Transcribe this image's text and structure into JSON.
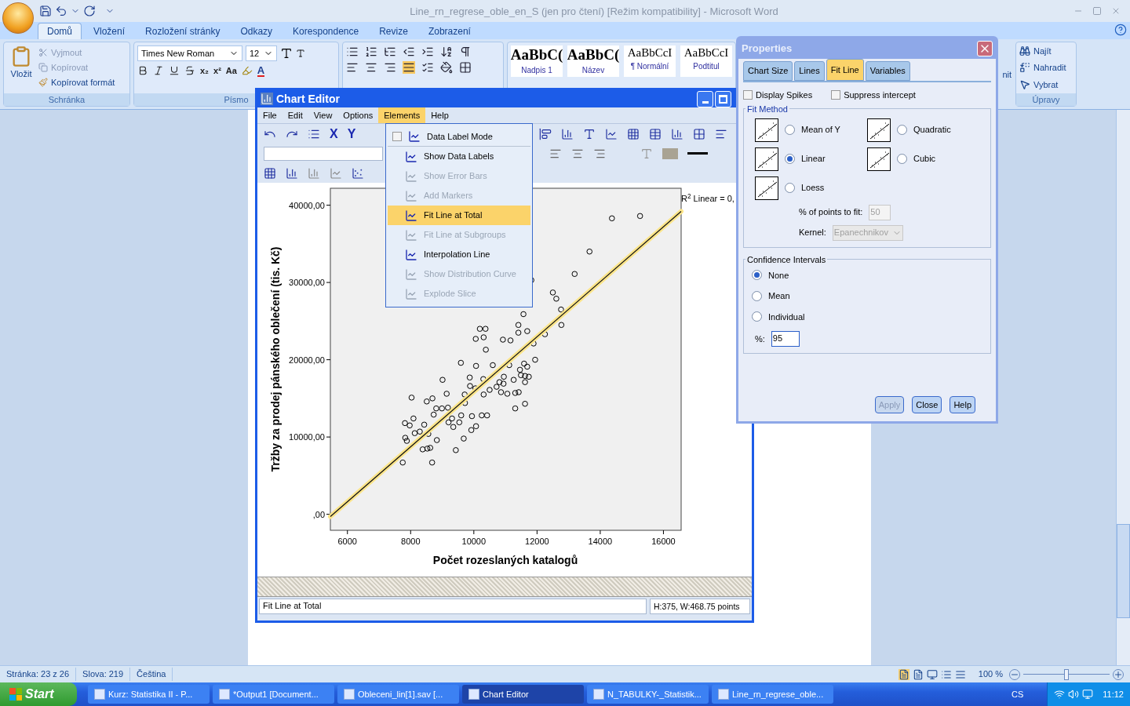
{
  "word": {
    "title": "Line_rn_regrese_oble_en_S (jen pro čtení) [Režim kompatibility] - Microsoft Word",
    "tabs": [
      {
        "label": "Domů",
        "selected": true
      },
      {
        "label": "Vložení",
        "selected": false
      },
      {
        "label": "Rozložení stránky",
        "selected": false
      },
      {
        "label": "Odkazy",
        "selected": false
      },
      {
        "label": "Korespondence",
        "selected": false
      },
      {
        "label": "Revize",
        "selected": false
      },
      {
        "label": "Zobrazení",
        "selected": false
      }
    ],
    "clipboard": {
      "paste": "Vložit",
      "group": "Schránka",
      "items": [
        {
          "label": "Vyjmout",
          "disabled": true
        },
        {
          "label": "Kopírovat",
          "disabled": true
        },
        {
          "label": "Kopírovat formát",
          "disabled": false
        }
      ]
    },
    "font": {
      "family": "Times New Roman",
      "size": "12",
      "group": "Písmo",
      "subscript": "x₂",
      "superscript": "x²",
      "case": "Aa",
      "color_letter": "A"
    },
    "styles": [
      {
        "sample": "AaBbC(",
        "name": "Nadpis 1",
        "bold": true
      },
      {
        "sample": "AaBbC(",
        "name": "Název",
        "bold": true
      },
      {
        "sample": "AaBbCcI",
        "name": "¶ Normální",
        "bold": false
      },
      {
        "sample": "AaBbCcI",
        "name": "Podtitul",
        "bold": false
      }
    ],
    "change_styles": "nit",
    "editing": {
      "group": "Úpravy",
      "items": [
        "Najít",
        "Nahradit",
        "Vybrat"
      ]
    },
    "status": [
      "Stránka: 23 z 26",
      "Slova: 219",
      "Čeština"
    ],
    "zoom": "100 %",
    "zoom_slider": {
      "level": 0.5
    }
  },
  "chart_editor": {
    "title": "Chart Editor",
    "menu": [
      {
        "label": "File",
        "selected": false
      },
      {
        "label": "Edit",
        "selected": false
      },
      {
        "label": "View",
        "selected": false
      },
      {
        "label": "Options",
        "selected": false
      },
      {
        "label": "Elements",
        "selected": true
      },
      {
        "label": "Help",
        "selected": false
      }
    ],
    "toolbar": {
      "x_axis": "X",
      "y_axis": "Y"
    },
    "elements_menu": [
      {
        "label": "Data Label Mode",
        "kind": "check",
        "checked": false,
        "disabled": false,
        "selected": false
      },
      {
        "label": "Show Data Labels",
        "kind": "item",
        "disabled": false,
        "selected": false
      },
      {
        "label": "Show Error Bars",
        "kind": "item",
        "disabled": true,
        "selected": false
      },
      {
        "label": "Add Markers",
        "kind": "item",
        "disabled": true,
        "selected": false
      },
      {
        "label": "Fit Line at Total",
        "kind": "item",
        "disabled": false,
        "selected": true
      },
      {
        "label": "Fit Line at Subgroups",
        "kind": "item",
        "disabled": true,
        "selected": false
      },
      {
        "label": "Interpolation Line",
        "kind": "item",
        "disabled": false,
        "selected": false
      },
      {
        "label": "Show Distribution Curve",
        "kind": "item",
        "disabled": true,
        "selected": false
      },
      {
        "label": "Explode Slice",
        "kind": "item",
        "disabled": true,
        "selected": false
      }
    ],
    "chart_data": {
      "type": "scatter",
      "xlabel": "Počet rozeslaných katalogů",
      "ylabel": "Tržby za prodej pánského oblečení (tis. Kč)",
      "x": [
        5460,
        16560,
        15260,
        14370,
        13660,
        13190,
        11820,
        12500,
        12610,
        12760,
        12770,
        12250,
        11570,
        11410,
        11410,
        11690,
        11890,
        11940,
        11160,
        10920,
        10370,
        10190,
        10310,
        10060,
        10380,
        9590,
        10070,
        10600,
        11120,
        11590,
        11690,
        11460,
        11490,
        11620,
        11740,
        11620,
        11260,
        10950,
        10810,
        10940,
        10720,
        10500,
        10300,
        9870,
        9880,
        10050,
        9710,
        10310,
        10860,
        11060,
        11310,
        11420,
        11310,
        11620,
        9720,
        9140,
        9010,
        8690,
        8510,
        8030,
        8810,
        8990,
        9180,
        8730,
        9310,
        9540,
        9600,
        9940,
        10250,
        10420,
        10070,
        9920,
        9200,
        9350,
        8090,
        7820,
        7970,
        8430,
        8130,
        8290,
        8560,
        7830,
        7880,
        8830,
        9680,
        8380,
        8530,
        8620,
        9430,
        7750,
        8680
      ],
      "series": [
        {
          "color": "#000000",
          "values": [
            null,
            null,
            38600,
            38300,
            34000,
            31100,
            30300,
            28700,
            27900,
            26500,
            24500,
            23300,
            25900,
            24500,
            23500,
            23700,
            22100,
            20000,
            22500,
            22600,
            24000,
            24000,
            22900,
            22700,
            21300,
            19600,
            19200,
            19300,
            19300,
            19500,
            19100,
            18700,
            18000,
            17900,
            17800,
            17100,
            17400,
            17800,
            17100,
            16900,
            16500,
            16100,
            17500,
            17700,
            16600,
            16300,
            15500,
            15500,
            15800,
            15600,
            15700,
            15800,
            13700,
            14300,
            14400,
            15600,
            17400,
            15000,
            14600,
            15100,
            13700,
            13700,
            13800,
            12900,
            12400,
            11900,
            12800,
            12700,
            12800,
            12800,
            11400,
            10900,
            11900,
            11300,
            12400,
            11800,
            11500,
            11600,
            10500,
            10700,
            10400,
            9900,
            9500,
            9600,
            9800,
            8400,
            8500,
            8600,
            8300,
            6700,
            6700
          ]
        },
        {
          "type": "line",
          "color": "#111111",
          "values": [
            -300,
            39200,
            null,
            null,
            null,
            null,
            null,
            null,
            null,
            null,
            null,
            null,
            null,
            null,
            null,
            null,
            null,
            null,
            null,
            null,
            null,
            null,
            null,
            null,
            null,
            null,
            null,
            null,
            null,
            null,
            null,
            null,
            null,
            null,
            null,
            null,
            null,
            null,
            null,
            null,
            null,
            null,
            null,
            null,
            null,
            null,
            null,
            null,
            null,
            null,
            null,
            null,
            null,
            null,
            null,
            null,
            null,
            null,
            null,
            null,
            null,
            null,
            null,
            null,
            null,
            null,
            null,
            null,
            null,
            null,
            null,
            null,
            null,
            null,
            null,
            null,
            null,
            null,
            null,
            null,
            null,
            null,
            null,
            null,
            null,
            null,
            null,
            null,
            null,
            null,
            null
          ]
        }
      ],
      "xlim": [
        5460,
        16560
      ],
      "ylim": [
        -2070,
        42190
      ],
      "xticks": [
        6000,
        8000,
        10000,
        12000,
        14000,
        16000
      ],
      "yticks": [
        {
          "value": 0,
          "label": ",00"
        },
        {
          "value": 10000,
          "label": "10000,00"
        },
        {
          "value": 20000,
          "label": "20000,00"
        },
        {
          "value": 30000,
          "label": "30000,00"
        },
        {
          "value": 40000,
          "label": "40000,00"
        }
      ]
    },
    "r2_label": "R$^{2}$ Linear = 0,",
    "status": "Fit Line at Total",
    "size": "H:375, W:468.75 points"
  },
  "properties": {
    "title": "Properties",
    "tabs": [
      {
        "label": "Chart Size",
        "selected": false
      },
      {
        "label": "Lines",
        "selected": false
      },
      {
        "label": "Fit Line",
        "selected": true
      },
      {
        "label": "Variables",
        "selected": false
      }
    ],
    "checks": [
      {
        "label": "Display Spikes",
        "checked": false
      },
      {
        "label": "Suppress intercept",
        "checked": false
      }
    ],
    "fit_method": {
      "legend": "Fit Method",
      "options": [
        {
          "label": "Mean of Y",
          "selected": false
        },
        {
          "label": "Linear",
          "selected": true
        },
        {
          "label": "Loess",
          "selected": false
        },
        {
          "label": "Quadratic",
          "selected": false
        },
        {
          "label": "Cubic",
          "selected": false
        }
      ],
      "points_label": "% of points to fit:",
      "points_value": "50",
      "kernel_label": "Kernel:",
      "kernel_value": "Epanechnikov"
    },
    "confidence": {
      "legend": "Confidence Intervals",
      "options": [
        {
          "label": "None",
          "selected": true
        },
        {
          "label": "Mean",
          "selected": false
        },
        {
          "label": "Individual",
          "selected": false
        }
      ],
      "percent_label": "%:",
      "percent_value": "95"
    },
    "buttons": [
      {
        "label": "Apply",
        "disabled": true
      },
      {
        "label": "Close",
        "disabled": false
      },
      {
        "label": "Help",
        "disabled": false
      }
    ]
  },
  "taskbar": {
    "start": "Start",
    "items": [
      {
        "label": "Kurz: Statistika II - P...",
        "selected": false
      },
      {
        "label": "*Output1 [Document...",
        "selected": false
      },
      {
        "label": "Obleceni_lin[1].sav [...",
        "selected": false
      },
      {
        "label": "Chart Editor",
        "selected": true
      },
      {
        "label": "N_TABULKY-_Statistik...",
        "selected": false
      },
      {
        "label": "Line_rn_regrese_oble...",
        "selected": false
      }
    ],
    "lang": "CS",
    "clock": "11:12"
  }
}
